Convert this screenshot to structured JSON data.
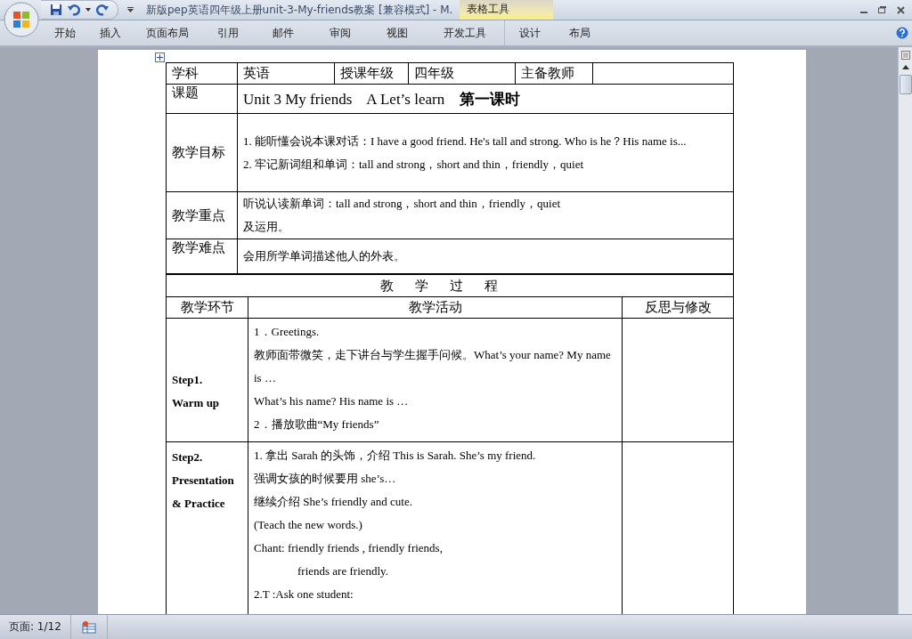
{
  "window": {
    "title": "新版pep英语四年级上册unit-3-My-friends教案 [兼容模式] - M.",
    "context_group": "表格工具"
  },
  "ribbon": {
    "tabs": [
      {
        "label": "开始",
        "selected": false
      },
      {
        "label": "插入",
        "selected": false
      },
      {
        "label": "页面布局",
        "selected": false
      },
      {
        "label": "引用",
        "selected": false
      },
      {
        "label": "邮件",
        "selected": false
      },
      {
        "label": "审阅",
        "selected": false
      },
      {
        "label": "视图",
        "selected": false
      },
      {
        "label": "开发工具",
        "selected": false
      },
      {
        "label": "设计",
        "selected": false,
        "kind": "context"
      },
      {
        "label": "布局",
        "selected": false,
        "kind": "context"
      }
    ]
  },
  "lesson_table": {
    "header": [
      "学科",
      "英语",
      "授课年级",
      "四年级",
      "主备教师"
    ],
    "topic_label": "课题",
    "topic": "Unit 3 My friends    A Let’s learn    **第一课时**",
    "objectives_label": "教学目标",
    "objectives": [
      "1. 能听懂会说本课对话：I have a good friend. He's tall and strong. Who is he？His name is...",
      "2. 牢记新词组和单词：tall and strong，short and thin，friendly，quiet"
    ],
    "key_points_label": "教学重点",
    "key_points": [
      "听说认读新单词：tall and strong，short and thin，friendly，quiet",
      "及运用。"
    ],
    "difficulty_label": "教学难点",
    "difficulty": "会用所学单词描述他人的外表。"
  },
  "process_table": {
    "title": "教学过程",
    "columns": [
      "教学环节",
      "教学活动",
      "反思与修改"
    ],
    "steps": [
      {
        "name": [
          "Step1.",
          "Warm up"
        ],
        "activities": [
          {
            "text": "1．Greetings.",
            "indented": false
          },
          {
            "text": "教师面带微笑，走下讲台与学生握手问候。What’s your name? My name is …",
            "indented": false
          },
          {
            "text": "What’s his name? His name is …",
            "indented": false
          },
          {
            "text": "2．播放歌曲“My friends”",
            "indented": false
          }
        ]
      },
      {
        "name": [
          "Step2.",
          "Presentation",
          "& Practice"
        ],
        "activities": [
          {
            "text": "1. 拿出 Sarah 的头饰，介绍 This is Sarah. She’s my friend.",
            "indented": false
          },
          {
            "text": "强调女孩的时候要用 she’s…",
            "indented": false
          },
          {
            "text": "继续介绍 She’s friendly and cute.",
            "indented": false
          },
          {
            "text": "(Teach the new words.)",
            "indented": false
          },
          {
            "text": "Chant: friendly friends , friendly friends,",
            "indented": false
          },
          {
            "text": "friends are friendly.",
            "indented": true
          },
          {
            "text": "2.T :Ask one student:",
            "indented": false
          }
        ]
      }
    ]
  },
  "status_bar": {
    "page": "页面: 1/12"
  }
}
